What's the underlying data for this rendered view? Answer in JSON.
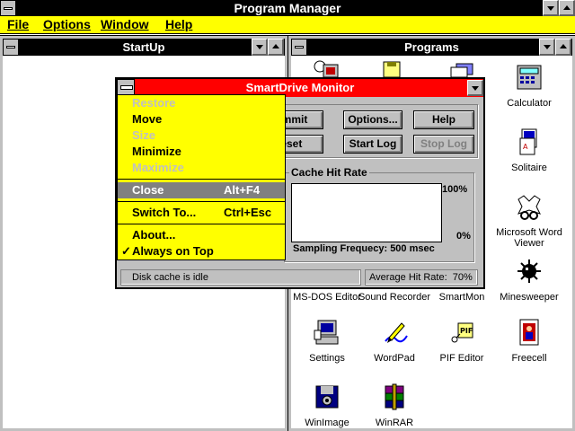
{
  "program_manager": {
    "title": "Program Manager",
    "menu": {
      "file": "File",
      "options": "Options",
      "window": "Window",
      "help": "Help"
    }
  },
  "startup": {
    "title": "StartUp"
  },
  "programs": {
    "title": "Programs",
    "icons": [
      {
        "label": "Calculator",
        "icon": "calculator-icon"
      },
      {
        "label": "Solitaire",
        "icon": "solitaire-icon"
      },
      {
        "label": "Microsoft Word Viewer",
        "icon": "word-viewer-icon"
      },
      {
        "label": "Minesweeper",
        "icon": "minesweeper-icon"
      },
      {
        "label": "MS-DOS Editor",
        "icon": "msdos-editor-icon"
      },
      {
        "label": "Sound Recorder",
        "icon": "sound-recorder-icon"
      },
      {
        "label": "SmartMon",
        "icon": "smartmon-icon"
      },
      {
        "label": "Settings",
        "icon": "settings-icon"
      },
      {
        "label": "WordPad",
        "icon": "wordpad-icon"
      },
      {
        "label": "PIF Editor",
        "icon": "pif-editor-icon"
      },
      {
        "label": "Freecell",
        "icon": "freecell-icon"
      },
      {
        "label": "WinImage",
        "icon": "winimage-icon"
      },
      {
        "label": "WinRAR",
        "icon": "winrar-icon"
      }
    ]
  },
  "smartdrive": {
    "title": "SmartDrive Monitor",
    "buttons": {
      "commit": "Commit",
      "options": "Options...",
      "help": "Help",
      "reset": "Reset",
      "start_log": "Start Log",
      "stop_log": "Stop Log"
    },
    "cache_group": "Cache Hit Rate",
    "scale_top": "100%",
    "scale_bottom": "0%",
    "sampling": "Sampling Frequecy: 500 msec",
    "status_left": "Disk cache is idle",
    "status_right": "Average Hit Rate:  70%"
  },
  "system_menu": {
    "items": [
      {
        "label": "Restore",
        "enabled": false
      },
      {
        "label": "Move",
        "enabled": true
      },
      {
        "label": "Size",
        "enabled": false
      },
      {
        "label": "Minimize",
        "enabled": true
      },
      {
        "label": "Maximize",
        "enabled": false
      },
      {
        "label": "Close",
        "shortcut": "Alt+F4",
        "enabled": true,
        "highlighted": true
      },
      {
        "label": "Switch To...",
        "shortcut": "Ctrl+Esc",
        "enabled": true
      },
      {
        "label": "About...",
        "enabled": true
      },
      {
        "label": "Always on Top",
        "enabled": true,
        "checked": true
      }
    ]
  },
  "colors": {
    "title_active": "#000000",
    "title_smartdrive": "#ff0000",
    "menu_bg": "#ffff00",
    "highlight": "#808080",
    "face": "#c0c0c0"
  }
}
